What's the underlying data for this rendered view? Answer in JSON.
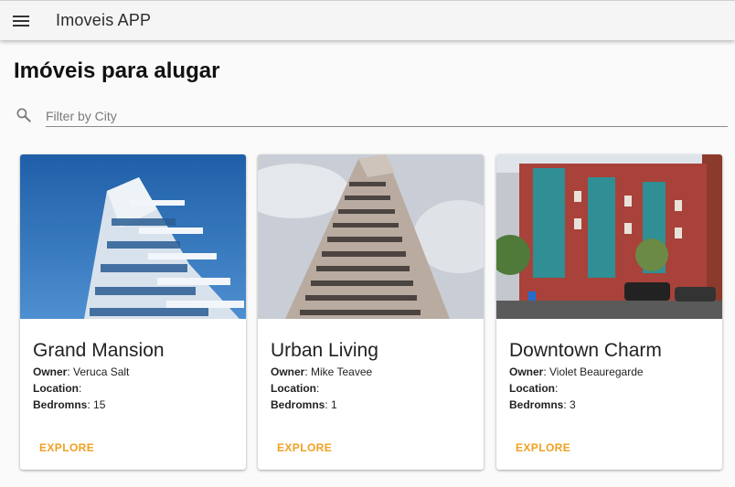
{
  "app": {
    "title": "Imoveis APP"
  },
  "page": {
    "title": "Imóveis para alugar"
  },
  "search": {
    "placeholder": "Filter by City",
    "value": ""
  },
  "labels": {
    "owner": "Owner",
    "location": "Location",
    "bedrooms": "Bedromns"
  },
  "properties": [
    {
      "name": "Grand Mansion",
      "owner": "Veruca Salt",
      "location": "",
      "bedrooms": "15",
      "action": "EXPLORE"
    },
    {
      "name": "Urban Living",
      "owner": "Mike Teavee",
      "location": "",
      "bedrooms": "1",
      "action": "EXPLORE"
    },
    {
      "name": "Downtown Charm",
      "owner": "Violet Beauregarde",
      "location": "",
      "bedrooms": "3",
      "action": "EXPLORE"
    }
  ],
  "colors": {
    "accent": "#f0a020",
    "appbar": "#f5f5f5",
    "background": "#fafafa"
  },
  "icons": {
    "menu": "menu-icon",
    "search": "search-icon"
  }
}
